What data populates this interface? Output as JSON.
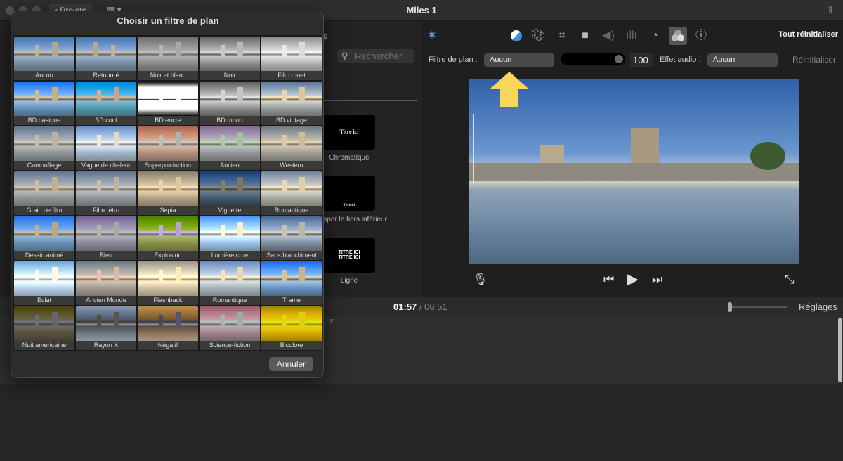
{
  "window": {
    "title": "Miles 1",
    "projects_button": "Projets"
  },
  "browser": {
    "tab_fragment": "ns",
    "search_placeholder": "Rechercher",
    "titles": [
      {
        "thumb": "Titre ici",
        "label": "Chromatique"
      },
      {
        "thumb": "Titre ici",
        "label": "relopper le tiers inférieur"
      },
      {
        "thumb": "TITRE ICI\nTITRE ICI",
        "label": "Ligne"
      }
    ]
  },
  "dialog": {
    "title": "Choisir un filtre de plan",
    "selected": "Aucun",
    "cancel": "Annuler",
    "filters": [
      "Aucun",
      "Retourné",
      "Noir et blanc",
      "Noir",
      "Film muet",
      "BD basique",
      "BD cool",
      "BD encre",
      "BD mono",
      "BD vintage",
      "Camouflage",
      "Vague de chaleur",
      "Superproduction",
      "Ancien",
      "Western",
      "Grain de film",
      "Film rétro",
      "Sépia",
      "Vignette",
      "Romantique",
      "Dessin animé",
      "Bleu",
      "Explosion",
      "Lumière crue",
      "Sans blanchiment",
      "Éclat",
      "Ancien Monde",
      "Flashback",
      "Romantique",
      "Trame",
      "Nuit américaine",
      "Rayon X",
      "Négatif",
      "Science-fiction",
      "Bicolore"
    ]
  },
  "inspector": {
    "tools": [
      "magic-wand-icon",
      "color-balance-icon",
      "palette-icon",
      "crop-icon",
      "stabilization-icon",
      "volume-icon",
      "equalizer-icon",
      "speed-icon",
      "filter-icon",
      "info-icon"
    ],
    "active_tool": "filter-icon",
    "reset_all": "Tout réinitialiser",
    "clip_filter_label": "Filtre de plan :",
    "clip_filter_value": "Aucun",
    "intensity": 100,
    "intensity_text": "100",
    "audio_effect_label": "Effet audio :",
    "audio_effect_value": "Aucun",
    "reset": "Réinitialiser"
  },
  "annotation": {
    "arrow_color": "#F9D55A"
  },
  "playback": {
    "current": "01:57",
    "separator": "/",
    "total": "06:51",
    "settings": "Réglages"
  }
}
